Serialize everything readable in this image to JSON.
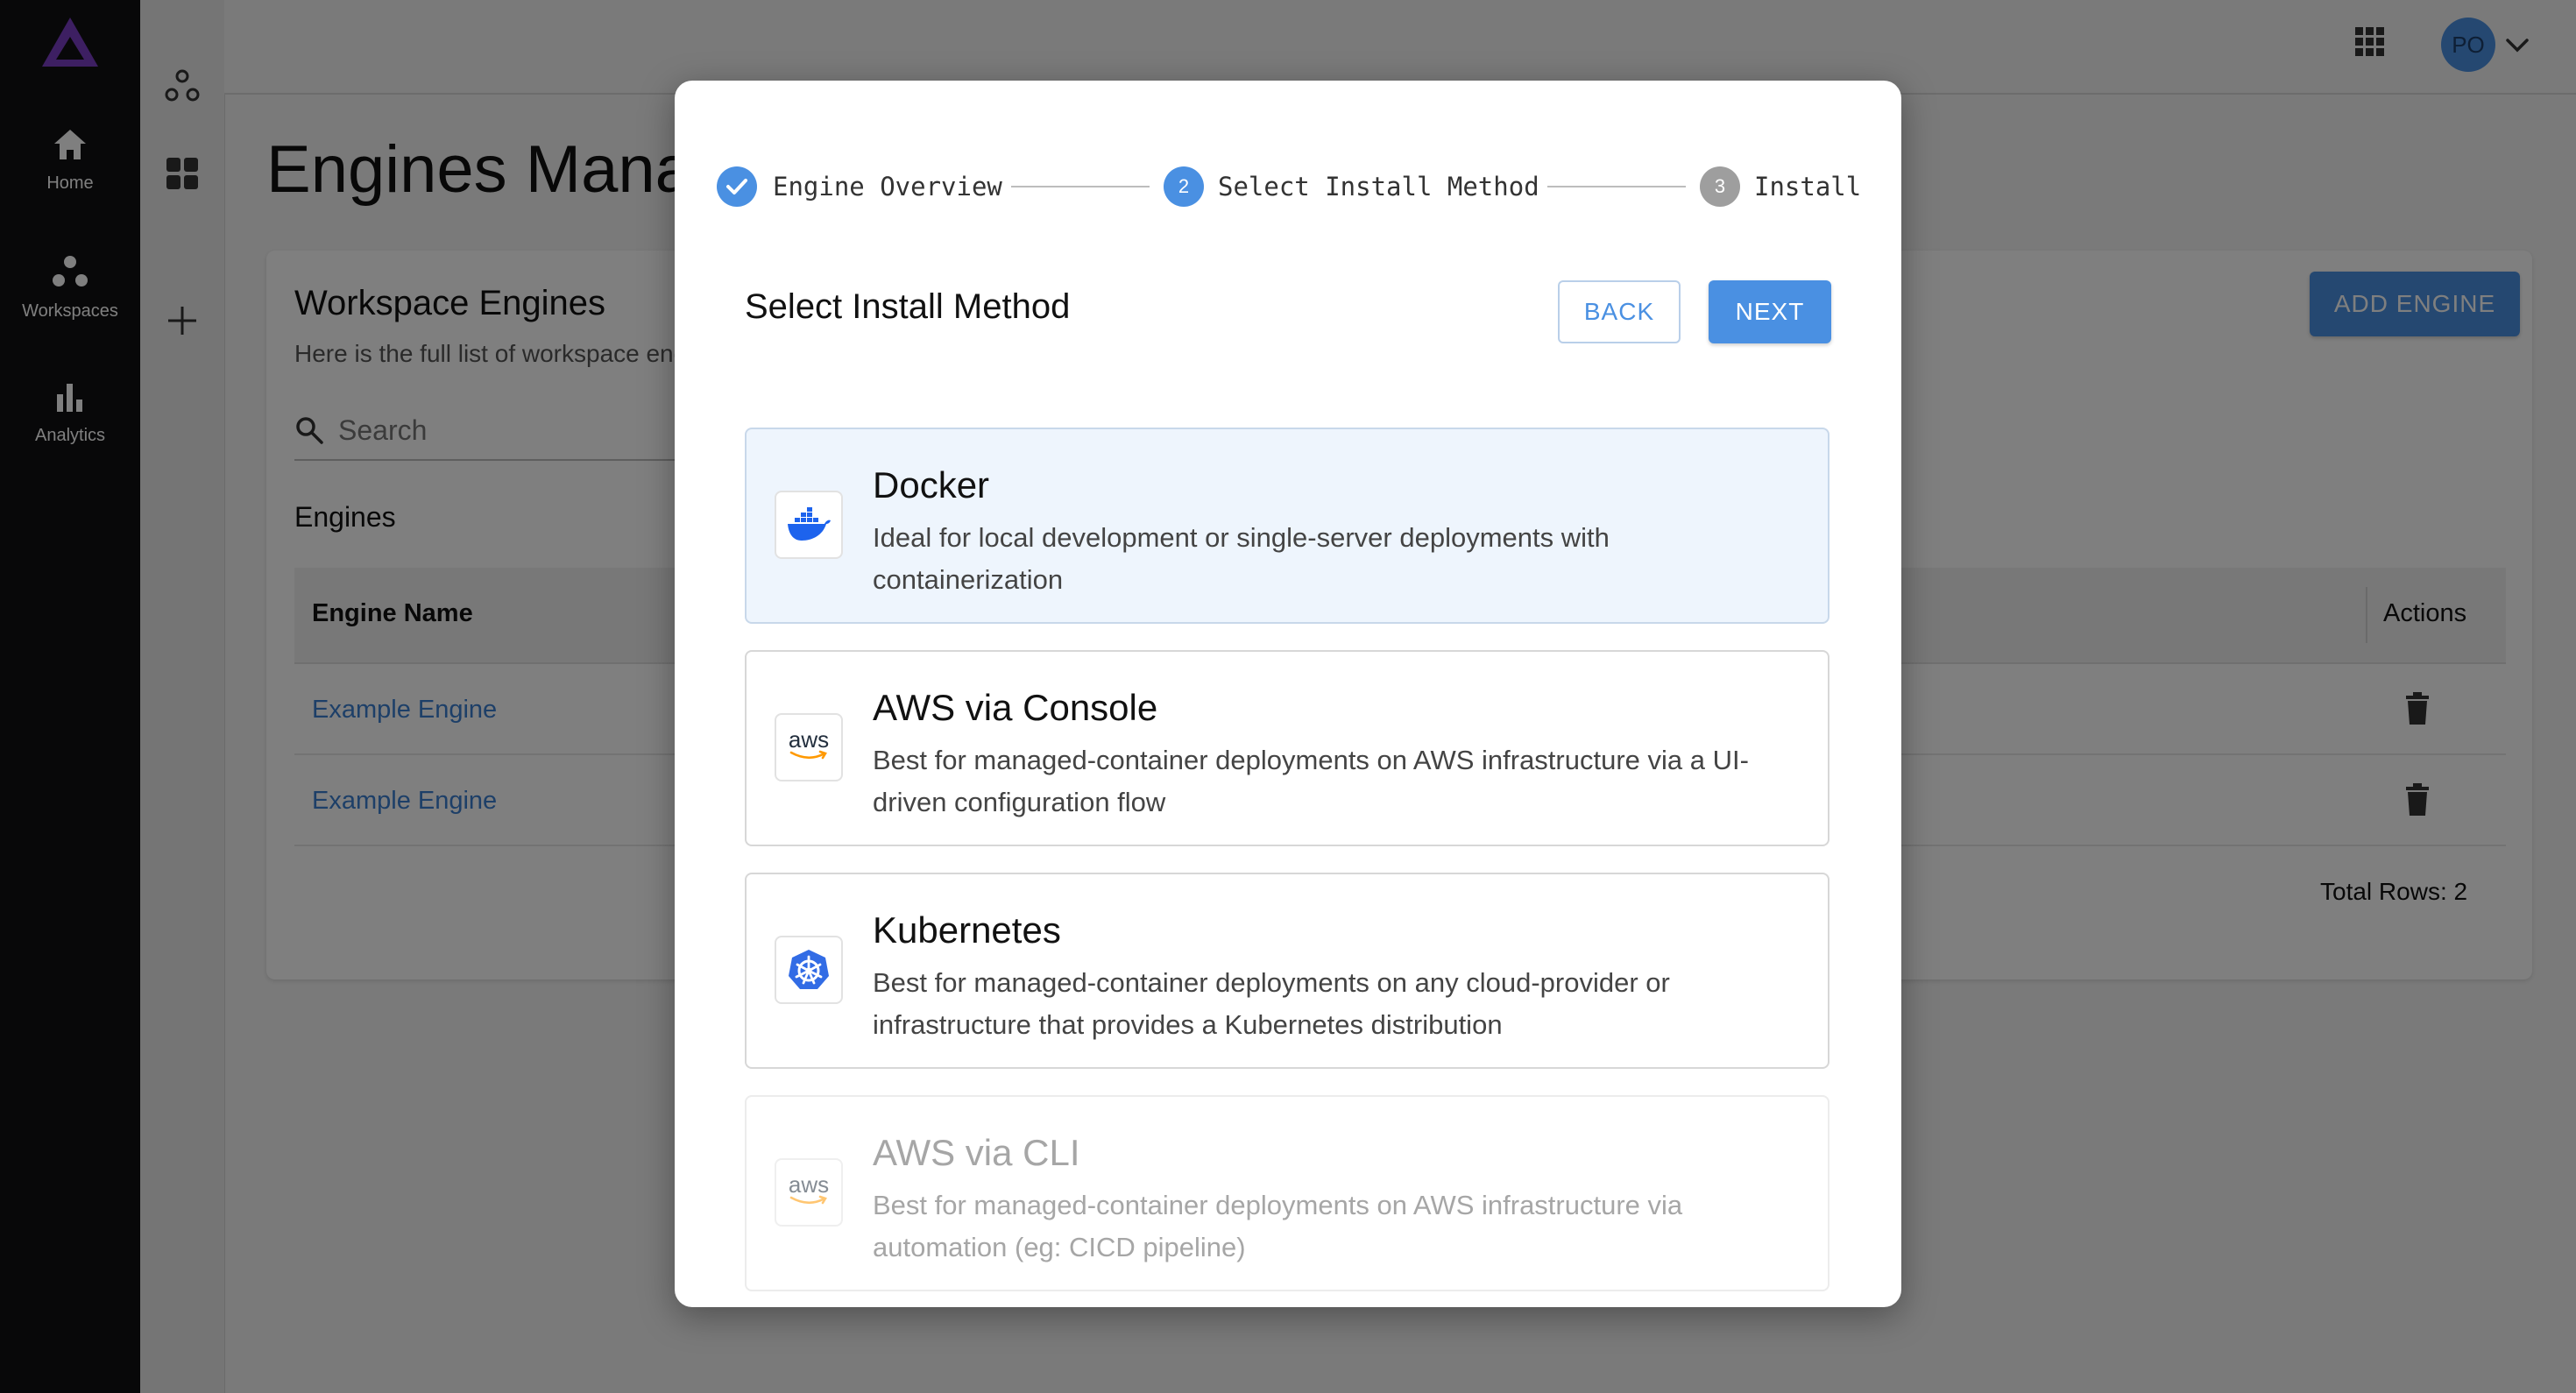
{
  "nav": {
    "items": [
      {
        "label": "Home",
        "icon": "home-icon"
      },
      {
        "label": "Workspaces",
        "icon": "workspaces-icon"
      },
      {
        "label": "Analytics",
        "icon": "analytics-icon"
      }
    ]
  },
  "topbar": {
    "avatar_initials": "PO"
  },
  "page": {
    "title": "Engines Management",
    "card_title": "Workspace Engines",
    "card_subtitle": "Here is the full list of workspace engines",
    "search_placeholder": "Search",
    "engines_label": "Engines",
    "add_engine_label": "ADD ENGINE",
    "table": {
      "columns": [
        "Engine Name",
        "Actions"
      ],
      "rows": [
        {
          "name": "Example Engine"
        },
        {
          "name": "Example Engine"
        }
      ],
      "total_rows_label": "Total Rows: 2"
    }
  },
  "modal": {
    "steps": [
      {
        "label": "Engine Overview",
        "state": "done"
      },
      {
        "number": "2",
        "label": "Select Install Method",
        "state": "active"
      },
      {
        "number": "3",
        "label": "Install",
        "state": "pending"
      }
    ],
    "title": "Select Install Method",
    "back_label": "BACK",
    "next_label": "NEXT",
    "options": [
      {
        "name": "Docker",
        "description": "Ideal for local development or single-server deployments with containerization",
        "icon": "docker-icon",
        "selected": true,
        "disabled": false
      },
      {
        "name": "AWS via Console",
        "description": "Best for managed-container deployments on AWS infrastructure via a UI-driven configuration flow",
        "icon": "aws-icon",
        "icon_text": "aws",
        "selected": false,
        "disabled": false
      },
      {
        "name": "Kubernetes",
        "description": "Best for managed-container deployments on any cloud-provider or infrastructure that provides a Kubernetes distribution",
        "icon": "kubernetes-icon",
        "selected": false,
        "disabled": false
      },
      {
        "name": "AWS via CLI",
        "description": "Best for managed-container deployments on AWS infrastructure via automation (eg: CICD pipeline)",
        "icon": "aws-icon",
        "icon_text": "aws",
        "selected": false,
        "disabled": true
      }
    ]
  },
  "colors": {
    "accent": "#4a90e2",
    "nav_bg": "#111113",
    "logo": "#7b3fc4",
    "link": "#3b7fd0",
    "selected_bg": "#eef5fd"
  }
}
